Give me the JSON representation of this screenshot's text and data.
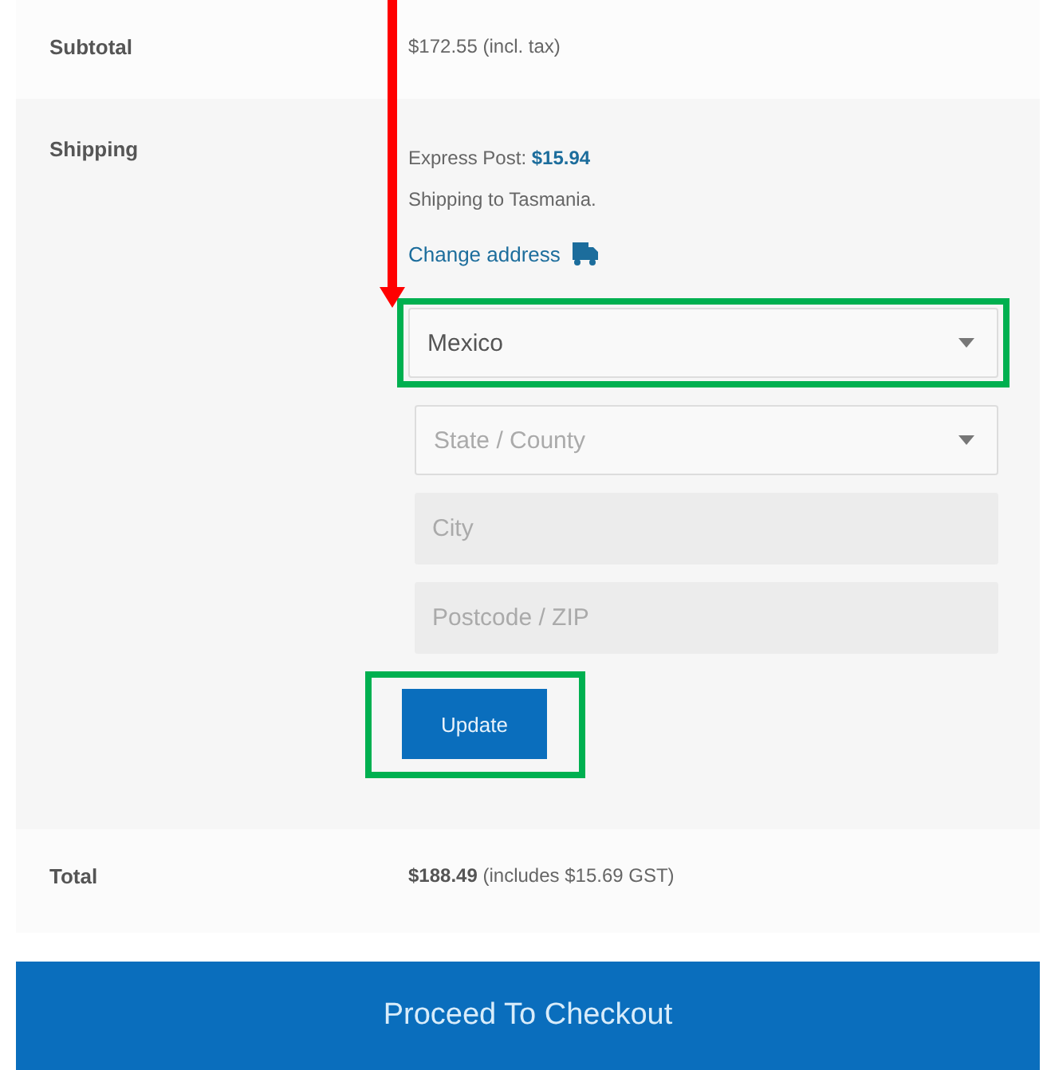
{
  "subtotal": {
    "label": "Subtotal",
    "amount": "$172.55",
    "note": "(incl. tax)"
  },
  "shipping": {
    "label": "Shipping",
    "method": "Express Post:",
    "price": "$15.94",
    "destination": "Shipping to Tasmania.",
    "change_link": "Change address",
    "fields": [
      {
        "kind": "select",
        "value": "Mexico",
        "highlighted": true
      },
      {
        "kind": "select",
        "placeholder": "State / County",
        "highlighted": false
      },
      {
        "kind": "text",
        "placeholder": "City",
        "highlighted": false
      },
      {
        "kind": "text",
        "placeholder": "Postcode / ZIP",
        "highlighted": false
      }
    ],
    "update_button": {
      "label": "Update",
      "highlighted": true
    }
  },
  "total": {
    "label": "Total",
    "amount": "$188.49",
    "note": "(includes $15.69 GST)"
  },
  "checkout_button": "Proceed To Checkout"
}
